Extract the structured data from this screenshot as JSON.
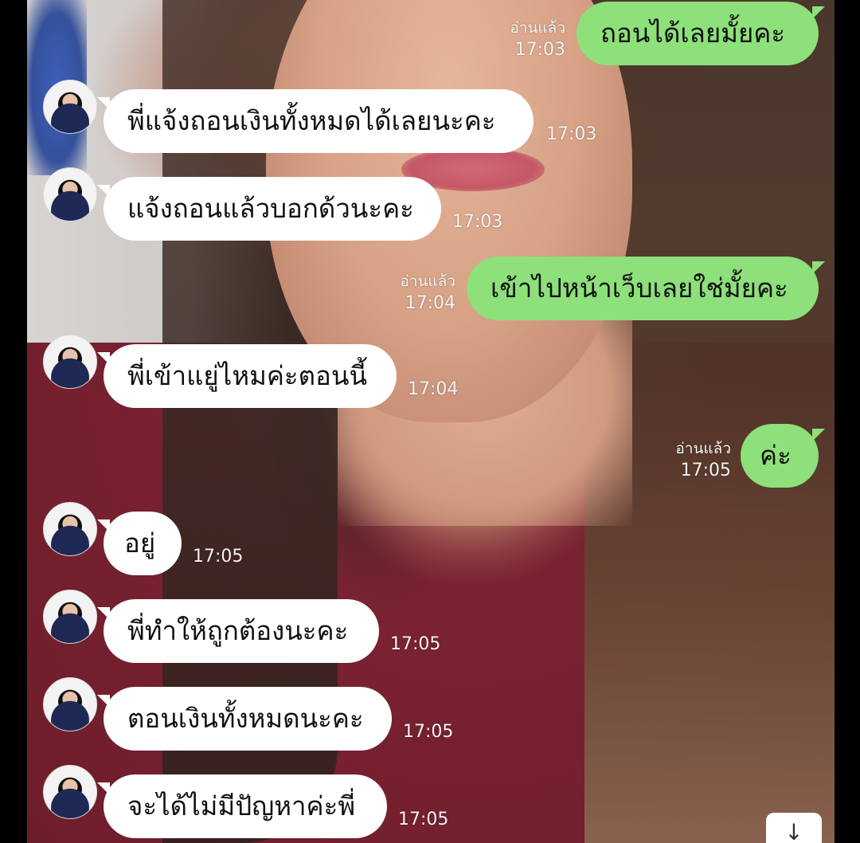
{
  "messages": [
    {
      "side": "out",
      "text": "ถอนได้เลยมั้ยคะ",
      "read": "อ่านแล้ว",
      "time": "17:03"
    },
    {
      "side": "in",
      "text": "พี่แจ้งถอนเงินทั้งหมดได้เลยนะคะ",
      "time": "17:03"
    },
    {
      "side": "in",
      "text": "แจ้งถอนแล้วบอกด้วนะคะ",
      "time": "17:03"
    },
    {
      "side": "out",
      "text": "เข้าไปหน้าเว็บเลยใช่มั้ยคะ",
      "read": "อ่านแล้ว",
      "time": "17:04"
    },
    {
      "side": "in",
      "text": "พี่เข้าแยู่ไหมค่ะตอนนี้",
      "time": "17:04"
    },
    {
      "side": "out",
      "text": "ค่ะ",
      "read": "อ่านแล้ว",
      "time": "17:05"
    },
    {
      "side": "in",
      "text": "อยู่",
      "time": "17:05"
    },
    {
      "side": "in",
      "text": "พี่ทำให้ถูกต้องนะคะ",
      "time": "17:05"
    },
    {
      "side": "in",
      "text": "ตอนเงินทั้งหมดนะคะ",
      "time": "17:05"
    },
    {
      "side": "in",
      "text": "จะได้ไม่มีปัญหาค่ะพี่",
      "time": "17:05"
    }
  ],
  "scroll_button": {
    "icon": "arrow-down-icon",
    "glyph": "↓"
  },
  "colors": {
    "incoming_bubble": "#ffffff",
    "outgoing_bubble": "#8de07a"
  }
}
